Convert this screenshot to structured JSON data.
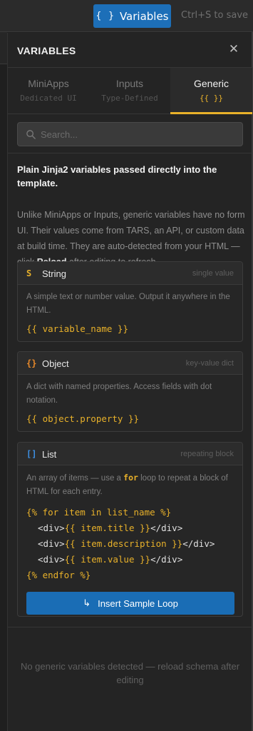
{
  "topbar": {
    "variables_button": {
      "icon": "{ }",
      "label": "Variables"
    },
    "save_hint": "Ctrl+S to save"
  },
  "panel": {
    "title": "VARIABLES",
    "close_icon": "✕",
    "tabs": [
      {
        "label": "MiniApps",
        "sublabel": "Dedicated UI",
        "active": false
      },
      {
        "label": "Inputs",
        "sublabel": "Type-Defined",
        "active": false
      },
      {
        "label": "Generic",
        "sublabel": "{{ }}",
        "active": true
      }
    ],
    "search": {
      "placeholder": "Search...",
      "value": ""
    },
    "intro": {
      "title": "Plain Jinja2 variables passed directly into the template.",
      "desc_before": "Unlike MiniApps or Inputs, generic variables have no form UI. Their values come from TARS, an API, or custom data at build time. They are auto-detected from your HTML — click ",
      "desc_bold": "Reload",
      "desc_after": " after editing to refresh."
    },
    "cards": [
      {
        "icon": "S",
        "name": "String",
        "tag": "single value",
        "desc": "A simple text or number value. Output it anywhere in the HTML.",
        "code": "{{ variable_name }}"
      },
      {
        "icon": "{}",
        "name": "Object",
        "tag": "key-value dict",
        "desc": "A dict with named properties. Access fields with dot notation.",
        "code": "{{ object.property }}"
      },
      {
        "icon": "[]",
        "name": "List",
        "tag": "repeating block",
        "desc_before": "An array of items — use a ",
        "desc_kw": "for",
        "desc_after": " loop to repeat a block of HTML for each entry.",
        "code_lines": {
          "l1": "{% for item in list_name %}",
          "l2_open": "<div>",
          "l2_var": "{{ item.title }}",
          "l2_close": "</div>",
          "l3_open": "<div>",
          "l3_var": "{{ item.description }}",
          "l3_close": "</div>",
          "l4_open": "<div>",
          "l4_var": "{{ item.value }}",
          "l4_close": "</div>",
          "l5": "{% endfor %}"
        },
        "button": {
          "icon": "↳",
          "label": "Insert Sample Loop"
        }
      }
    ],
    "empty_message": "No generic variables detected — reload schema after editing"
  },
  "colors": {
    "accent_yellow": "#e8b12a",
    "accent_blue": "#1d6fb8",
    "background": "#242424"
  }
}
